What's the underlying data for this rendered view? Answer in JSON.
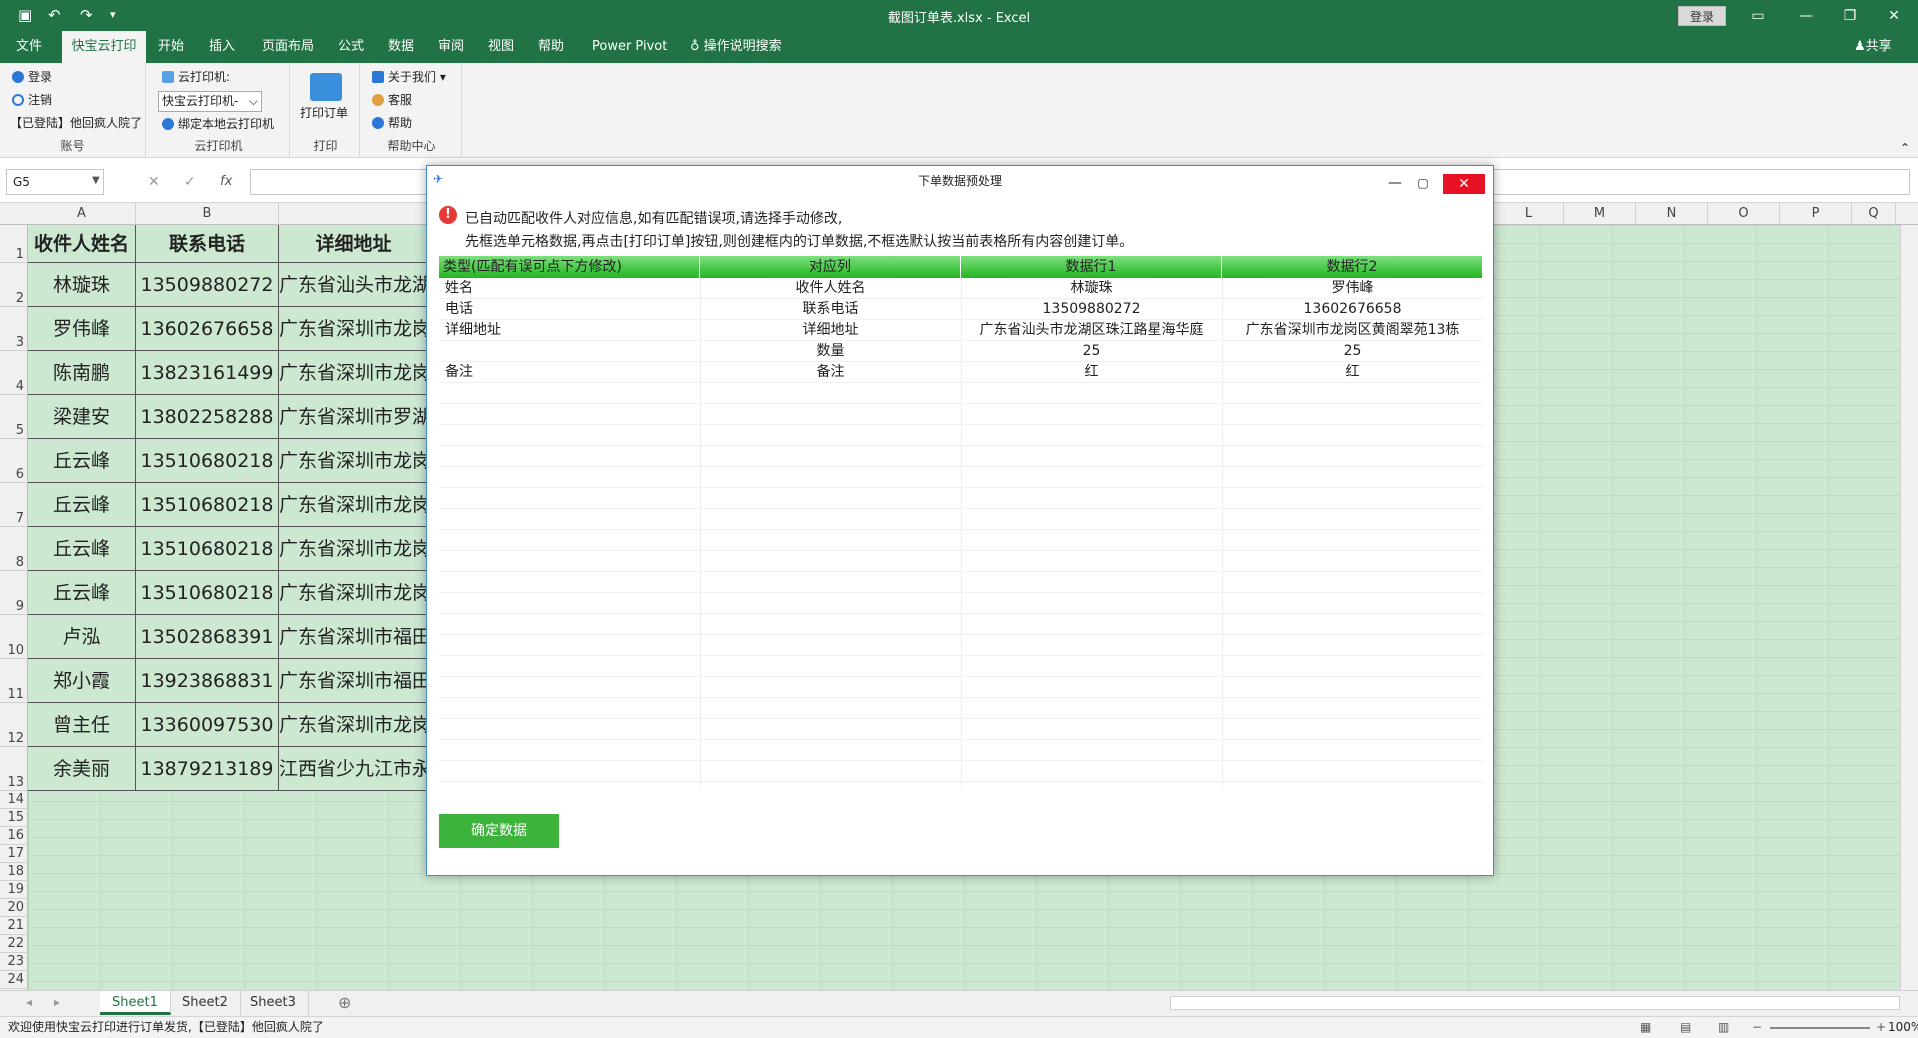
{
  "window": {
    "title": "截图订单表.xlsx  -  Excel",
    "login": "登录",
    "share": "共享"
  },
  "tabs": [
    "文件",
    "快宝云打印",
    "开始",
    "插入",
    "页面布局",
    "公式",
    "数据",
    "审阅",
    "视图",
    "帮助",
    "Power Pivot",
    "操作说明搜索"
  ],
  "ribbon": {
    "account": {
      "login": "登录",
      "logout": "注销",
      "status": "【已登陆】他回疯人院了",
      "label": "账号"
    },
    "cloud": {
      "printer_label": "云打印机:",
      "printer_value": "快宝云打印机-",
      "bind": "绑定本地云打印机",
      "label": "云打印机"
    },
    "print": {
      "button": "打印订单",
      "label": "打印"
    },
    "help": {
      "about": "关于我们",
      "service": "客服",
      "help": "帮助",
      "label": "帮助中心"
    }
  },
  "formula": {
    "namebox": "G5"
  },
  "columns": [
    "A",
    "B",
    "",
    "",
    "",
    "",
    "",
    "",
    "",
    "",
    "L",
    "M",
    "N",
    "O",
    "P",
    "Q"
  ],
  "rows": [
    "1",
    "2",
    "3",
    "4",
    "5",
    "6",
    "7",
    "8",
    "9",
    "10",
    "11",
    "12",
    "13",
    "14",
    "15",
    "16",
    "17",
    "18",
    "19",
    "20",
    "21",
    "22",
    "23",
    "24"
  ],
  "sheet": {
    "header": [
      "收件人姓名",
      "联系电话",
      "详细地址"
    ],
    "data": [
      [
        "林璇珠",
        "13509880272",
        "广东省汕头市龙湖"
      ],
      [
        "罗伟峰",
        "13602676658",
        "广东省深圳市龙岗"
      ],
      [
        "陈南鹏",
        "13823161499",
        "广东省深圳市龙岗"
      ],
      [
        "梁建安",
        "13802258288",
        "广东省深圳市罗湖"
      ],
      [
        "丘云峰",
        "13510680218",
        "广东省深圳市龙岗"
      ],
      [
        "丘云峰",
        "13510680218",
        "广东省深圳市龙岗"
      ],
      [
        "丘云峰",
        "13510680218",
        "广东省深圳市龙岗"
      ],
      [
        "丘云峰",
        "13510680218",
        "广东省深圳市龙岗"
      ],
      [
        "卢泓",
        "13502868391",
        "广东省深圳市福田"
      ],
      [
        "郑小霞",
        "13923868831",
        "广东省深圳市福田"
      ],
      [
        "曾主任",
        "13360097530",
        "广东省深圳市龙岗"
      ],
      [
        "余美丽",
        "13879213189",
        "江西省少九江市永"
      ]
    ]
  },
  "sheet_tabs": [
    "Sheet1",
    "Sheet2",
    "Sheet3"
  ],
  "status": {
    "text": "欢迎使用快宝云打印进行订单发货,【已登陆】他回疯人院了",
    "zoom": "100%"
  },
  "dialog": {
    "title": "下单数据预处理",
    "msg1": "已自动匹配收件人对应信息,如有匹配错误项,请选择手动修改,",
    "msg2": "先框选单元格数据,再点击[打印订单]按钮,则创建框内的订单数据,不框选默认按当前表格所有内容创建订单。",
    "columns": [
      "类型(匹配有误可点下方修改)",
      "对应列",
      "数据行1",
      "数据行2"
    ],
    "rows": [
      [
        "姓名",
        "收件人姓名",
        "林璇珠",
        "罗伟峰"
      ],
      [
        "电话",
        "联系电话",
        "13509880272",
        "13602676658"
      ],
      [
        "详细地址",
        "详细地址",
        "广东省汕头市龙湖区珠江路星海华庭",
        "广东省深圳市龙岗区黄阁翠苑13栋"
      ],
      [
        "",
        "数量",
        "25",
        "25"
      ],
      [
        "备注",
        "备注",
        "红",
        "红"
      ]
    ],
    "confirm": "确定数据"
  }
}
